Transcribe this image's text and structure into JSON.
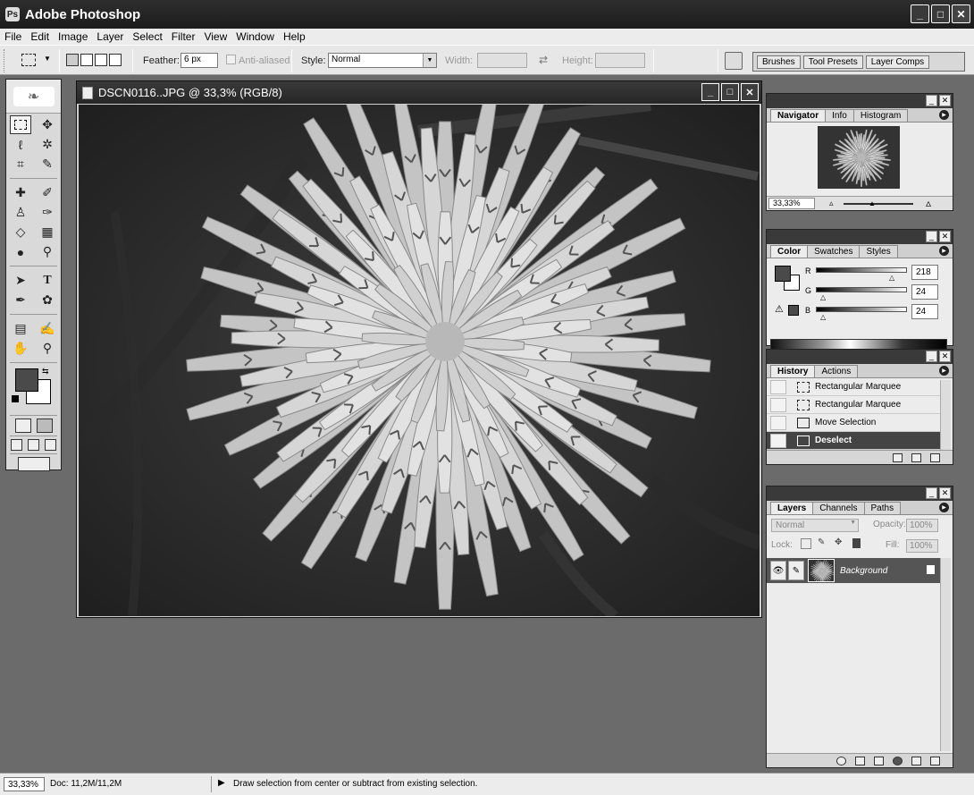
{
  "app": {
    "title": "Adobe Photoshop"
  },
  "menu": [
    "File",
    "Edit",
    "Image",
    "Layer",
    "Select",
    "Filter",
    "View",
    "Window",
    "Help"
  ],
  "options": {
    "feather_label": "Feather:",
    "feather_value": "6 px",
    "antialiased_label": "Anti-aliased",
    "style_label": "Style:",
    "style_value": "Normal",
    "width_label": "Width:",
    "height_label": "Height:",
    "wells": [
      "Brushes",
      "Tool Presets",
      "Layer Comps"
    ]
  },
  "document": {
    "title": "DSCN0116..JPG @ 33,3% (RGB/8)"
  },
  "navigator": {
    "tabs": [
      "Navigator",
      "Info",
      "Histogram"
    ],
    "zoom": "33,33%"
  },
  "color": {
    "tabs": [
      "Color",
      "Swatches",
      "Styles"
    ],
    "r_label": "R",
    "r_value": "218",
    "g_label": "G",
    "g_value": "24",
    "b_label": "B",
    "b_value": "24"
  },
  "history": {
    "tabs": [
      "History",
      "Actions"
    ],
    "items": [
      "Rectangular Marquee",
      "Rectangular Marquee",
      "Move Selection",
      "Deselect"
    ]
  },
  "layers": {
    "tabs": [
      "Layers",
      "Channels",
      "Paths"
    ],
    "blend_mode": "Normal",
    "opacity_label": "Opacity:",
    "opacity_value": "100%",
    "lock_label": "Lock:",
    "fill_label": "Fill:",
    "fill_value": "100%",
    "layer_name": "Background"
  },
  "status": {
    "zoom": "33,33%",
    "doc": "Doc: 11,2M/11,2M",
    "message": "Draw selection from center or subtract from existing selection."
  },
  "colors": {
    "foreground": "#4a4a4a",
    "background": "#ffffff",
    "workspace": "#6b6b6b"
  }
}
